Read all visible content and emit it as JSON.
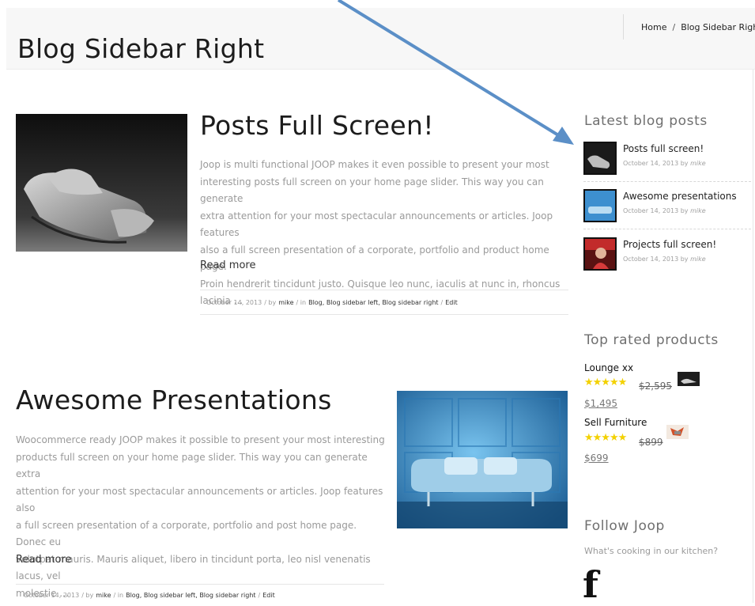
{
  "header": {
    "page_title": "Blog Sidebar Right",
    "breadcrumb": {
      "home": "Home",
      "separator": "/",
      "current": "Blog Sidebar Right"
    }
  },
  "posts": [
    {
      "title": "Posts Full Screen!",
      "excerpt_lines": [
        "Joop is multi functional JOOP makes it even possible to present your most",
        "interesting posts full screen on your home page slider. This way you can generate",
        "extra attention for your most spectacular announcements or articles. Joop features",
        "also a full screen presentation of a corporate, portfolio and product home page.",
        "Proin hendrerit tincidunt justo. Quisque leo nunc, iaculis at nunc in, rhoncus lacinia ..."
      ],
      "read_more": "Read more",
      "meta": {
        "date": "October 14, 2013",
        "by_sep": "/ by",
        "author": "mike",
        "in_sep": "/ in",
        "categories": "Blog, Blog sidebar left, Blog sidebar right",
        "edit_sep": "/",
        "edit": "Edit"
      }
    },
    {
      "title": "Awesome Presentations",
      "excerpt_lines": [
        "Woocommerce ready JOOP makes it possible to present your most interesting",
        "products full screen on your home page slider. This way you can generate extra",
        "attention for your most spectacular announcements or articles. Joop features also",
        "a full screen presentation of a corporate, portfolio and post home page. Donec eu",
        "volutpat mauris. Mauris aliquet, libero in tincidunt porta, leo nisl venenatis lacus, vel",
        "molestie ..."
      ],
      "read_more": "Read more",
      "meta": {
        "date": "October 14, 2013",
        "by_sep": "/ by",
        "author": "mike",
        "in_sep": "/ in",
        "categories": "Blog, Blog sidebar left, Blog sidebar right",
        "edit_sep": "/",
        "edit": "Edit"
      }
    }
  ],
  "sidebar": {
    "latest": {
      "title": "Latest blog posts",
      "items": [
        {
          "title": "Posts full screen!",
          "date": "October 14, 2013 by",
          "author": "mike"
        },
        {
          "title": "Awesome presentations",
          "date": "October 14, 2013 by",
          "author": "mike"
        },
        {
          "title": "Projects full screen!",
          "date": "October 14, 2013 by",
          "author": "mike"
        }
      ]
    },
    "top_rated": {
      "title": "Top rated products",
      "products": [
        {
          "name": "Lounge xx",
          "rating": 5,
          "stars": "★★★★★",
          "old_price": "$2,595",
          "new_price": "$1,495"
        },
        {
          "name": "Sell Furniture",
          "rating": 5,
          "stars": "★★★★★",
          "old_price": "$899",
          "new_price": "$699"
        }
      ]
    },
    "follow": {
      "title": "Follow Joop",
      "subtitle": "What's cooking in our kitchen?",
      "icon_glyph": "f"
    }
  },
  "colors": {
    "arrow": "#5b8fc7",
    "star": "#f3d100",
    "header_bg": "#f7f7f7",
    "excerpt_text": "#9a9a9a"
  },
  "icons": [
    "arrow-annotation",
    "facebook-icon",
    "star-icon"
  ]
}
